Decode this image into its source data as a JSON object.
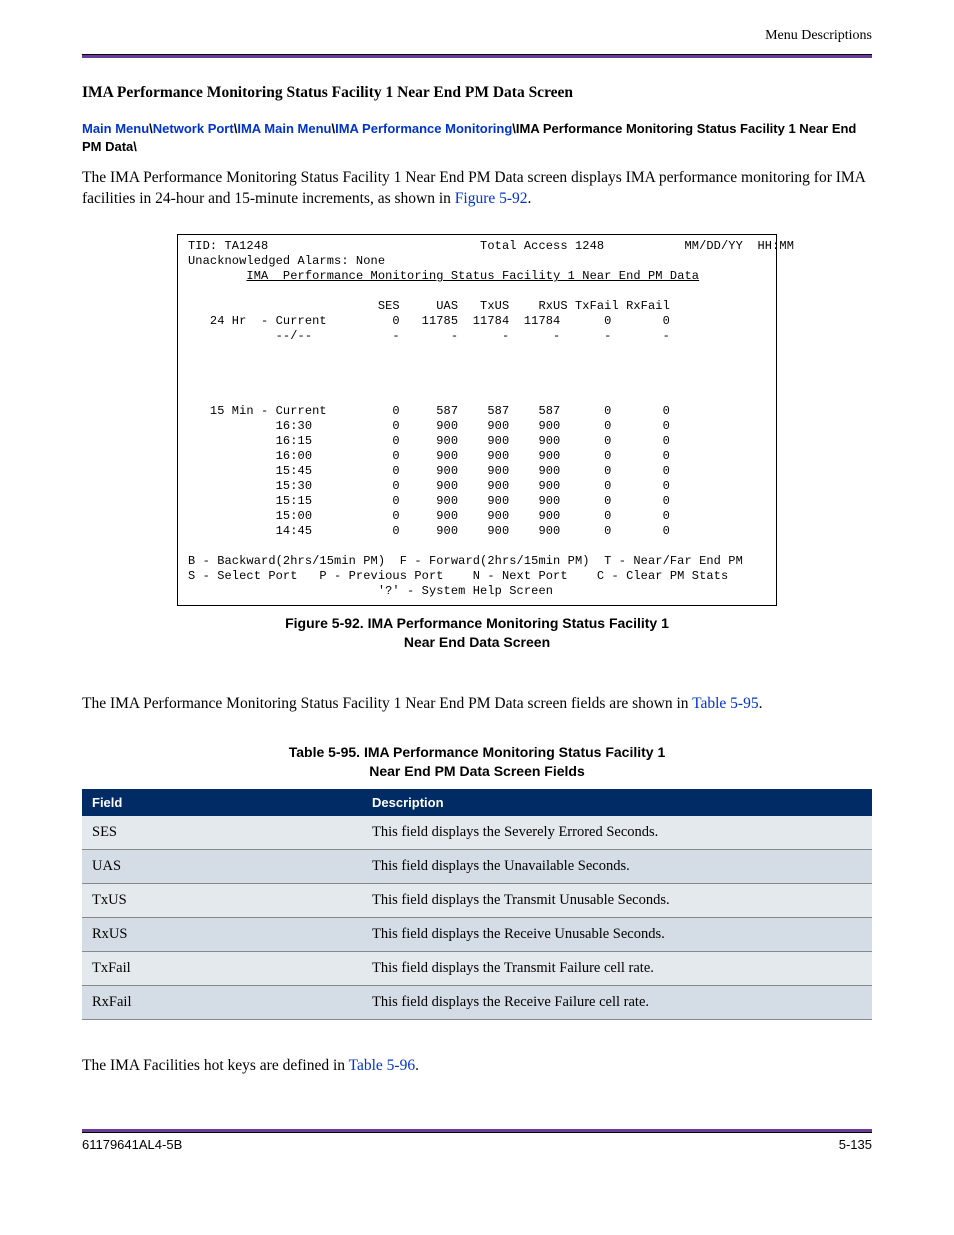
{
  "header": {
    "context": "Menu Descriptions"
  },
  "heading": "IMA Performance Monitoring Status Facility 1 Near End PM Data Screen",
  "breadcrumb": {
    "links": [
      {
        "text": "Main Menu"
      },
      {
        "text": "Network Port"
      },
      {
        "text": "IMA Main Menu"
      },
      {
        "text": "IMA Performance Monitoring"
      }
    ],
    "sep": "\\",
    "tail": "IMA Performance Monitoring Status Facility 1 Near End PM Data\\"
  },
  "intro": {
    "text_before": "The IMA Performance Monitoring Status Facility 1 Near End PM Data screen displays IMA performance monitoring for IMA facilities in 24-hour and 15-minute increments, as shown in ",
    "ref": "Figure 5-92",
    "text_after": "."
  },
  "terminal": {
    "tid": "TID: TA1248",
    "center": "Total Access 1248",
    "datetime": "MM/DD/YY  HH:MM",
    "alarms": "Unacknowledged Alarms: None",
    "title": "IMA  Performance Monitoring Status Facility 1 Near End PM Data",
    "col_headers": [
      "SES",
      "UAS",
      "TxUS",
      "RxUS",
      "TxFail",
      "RxFail"
    ],
    "row_24hr_label": "24 Hr  - Current",
    "row_24hr": [
      "0",
      "11785",
      "11784",
      "11784",
      "0",
      "0"
    ],
    "row_dash_label": "--/--",
    "row_dash": [
      "-",
      "-",
      "-",
      "-",
      "-",
      "-"
    ],
    "row_15min_label": "15 Min - Current",
    "rows_15": [
      {
        "label": "Current",
        "vals": [
          "0",
          "587",
          "587",
          "587",
          "0",
          "0"
        ]
      },
      {
        "label": "16:30",
        "vals": [
          "0",
          "900",
          "900",
          "900",
          "0",
          "0"
        ]
      },
      {
        "label": "16:15",
        "vals": [
          "0",
          "900",
          "900",
          "900",
          "0",
          "0"
        ]
      },
      {
        "label": "16:00",
        "vals": [
          "0",
          "900",
          "900",
          "900",
          "0",
          "0"
        ]
      },
      {
        "label": "15:45",
        "vals": [
          "0",
          "900",
          "900",
          "900",
          "0",
          "0"
        ]
      },
      {
        "label": "15:30",
        "vals": [
          "0",
          "900",
          "900",
          "900",
          "0",
          "0"
        ]
      },
      {
        "label": "15:15",
        "vals": [
          "0",
          "900",
          "900",
          "900",
          "0",
          "0"
        ]
      },
      {
        "label": "15:00",
        "vals": [
          "0",
          "900",
          "900",
          "900",
          "0",
          "0"
        ]
      },
      {
        "label": "14:45",
        "vals": [
          "0",
          "900",
          "900",
          "900",
          "0",
          "0"
        ]
      }
    ],
    "hotkeys_line1": "B - Backward(2hrs/15min PM)  F - Forward(2hrs/15min PM)  T - Near/Far End PM",
    "hotkeys_line2": "S - Select Port   P - Previous Port    N - Next Port    C - Clear PM Stats",
    "help_line": "'?' - System Help Screen"
  },
  "figure_caption": {
    "prefix": "Figure 5-92.  ",
    "line1": "IMA Performance Monitoring Status Facility 1",
    "line2": "Near End Data Screen"
  },
  "para2": {
    "text_before": "The IMA Performance Monitoring Status Facility 1 Near End PM Data screen fields are shown in ",
    "ref": "Table 5-95",
    "text_after": "."
  },
  "table_caption": {
    "prefix": "Table 5-95.  ",
    "line1": "IMA Performance Monitoring Status Facility 1",
    "line2": "Near End PM Data Screen Fields"
  },
  "table": {
    "headers": [
      "Field",
      "Description"
    ],
    "rows": [
      {
        "field": "SES",
        "desc": "This field displays the Severely Errored Seconds."
      },
      {
        "field": "UAS",
        "desc": "This field displays the Unavailable Seconds."
      },
      {
        "field": "TxUS",
        "desc": "This field displays the Transmit Unusable Seconds."
      },
      {
        "field": "RxUS",
        "desc": "This field displays the Receive Unusable Seconds."
      },
      {
        "field": "TxFail",
        "desc": "This field displays the Transmit Failure cell rate."
      },
      {
        "field": "RxFail",
        "desc": "This field displays the Receive Failure cell rate."
      }
    ]
  },
  "closing": {
    "text_before": "The IMA Facilities hot keys are defined in ",
    "ref": "Table 5-96",
    "text_after": "."
  },
  "footer": {
    "docnum": "61179641AL4-5B",
    "pagenum": "5-135"
  }
}
